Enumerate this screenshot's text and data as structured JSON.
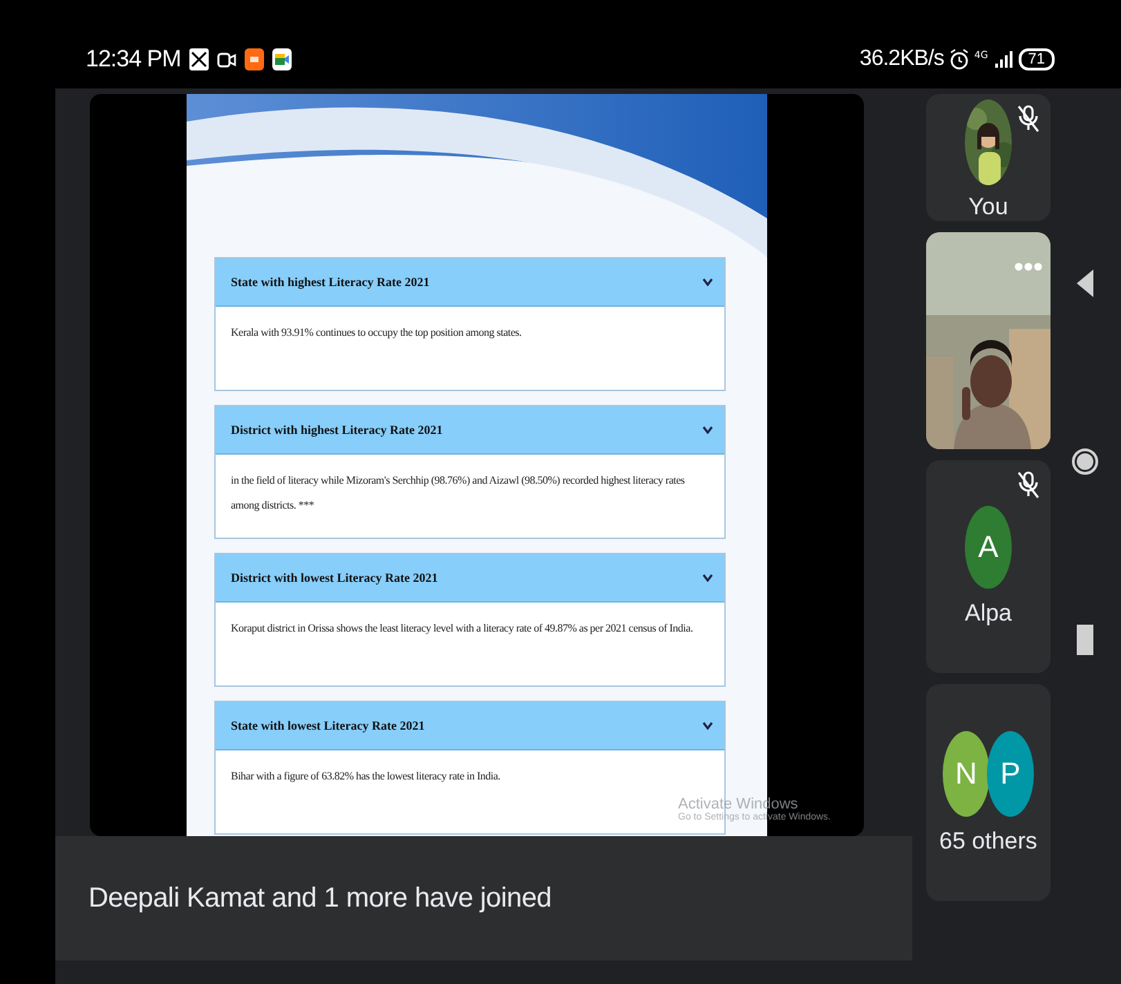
{
  "status_bar": {
    "time": "12:34 PM",
    "network_speed": "36.2KB/s",
    "network_type": "4G",
    "battery": "71"
  },
  "shared_screen": {
    "panels": [
      {
        "title": "State with highest Literacy Rate 2021",
        "body": "Kerala with 93.91% continues to occupy the top position among states."
      },
      {
        "title": "District with highest Literacy Rate 2021",
        "body": "in the field of literacy while Mizoram's Serchhip (98.76%) and Aizawl (98.50%) recorded highest literacy rates among districts. ***"
      },
      {
        "title": "District with lowest Literacy Rate 2021",
        "body": "Koraput district in Orissa shows the least literacy level with a literacy rate of 49.87% as per 2021 census of India."
      },
      {
        "title": "State with lowest Literacy Rate 2021",
        "body": "Bihar with a figure of 63.82% has the lowest literacy rate in India."
      }
    ],
    "system_notice": {
      "title": "Activate Windows",
      "subtitle": "Go to Settings to activate Windows."
    }
  },
  "participants": [
    {
      "name": "You",
      "muted": true
    },
    {
      "kind": "video"
    },
    {
      "kind": "initial",
      "initial": "A",
      "color": "#2e7d32",
      "name": "Alpa",
      "muted": true
    },
    {
      "kind": "group",
      "avatars": [
        {
          "initial": "N",
          "color": "#7cb342"
        },
        {
          "initial": "P",
          "color": "#0097a7"
        }
      ],
      "name": "65 others"
    }
  ],
  "toast": "Deepali Kamat and 1 more have joined"
}
